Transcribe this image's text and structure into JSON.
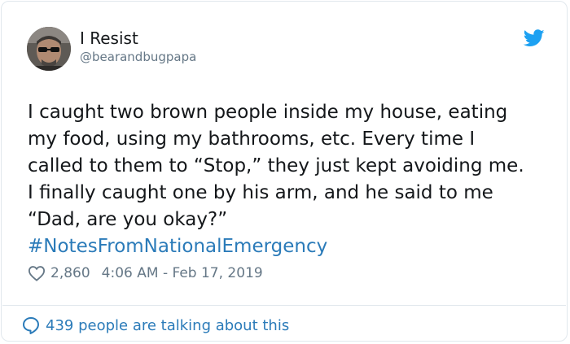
{
  "author": {
    "name": "I Resist",
    "handle": "@bearandbugpapa",
    "avatar_icon": "avatar-photo",
    "platform_icon": "twitter-bird-icon"
  },
  "tweet": {
    "text": "I caught two brown people inside my house, eating\nmy food, using my bathrooms, etc. Every time I\ncalled to them to “Stop,” they just kept avoiding me.\nI finally caught one by his arm, and he said to me\n“Dad, are you okay?”",
    "hashtag": "#NotesFromNationalEmergency",
    "likes": "2,860",
    "timestamp": "4:06 AM - Feb 17, 2019"
  },
  "footer": {
    "talking": "439 people are talking about this"
  },
  "colors": {
    "link": "#2b7bb9",
    "secondary_text": "#657786",
    "border": "#e1e8ed",
    "twitter_blue": "#1da1f2"
  }
}
